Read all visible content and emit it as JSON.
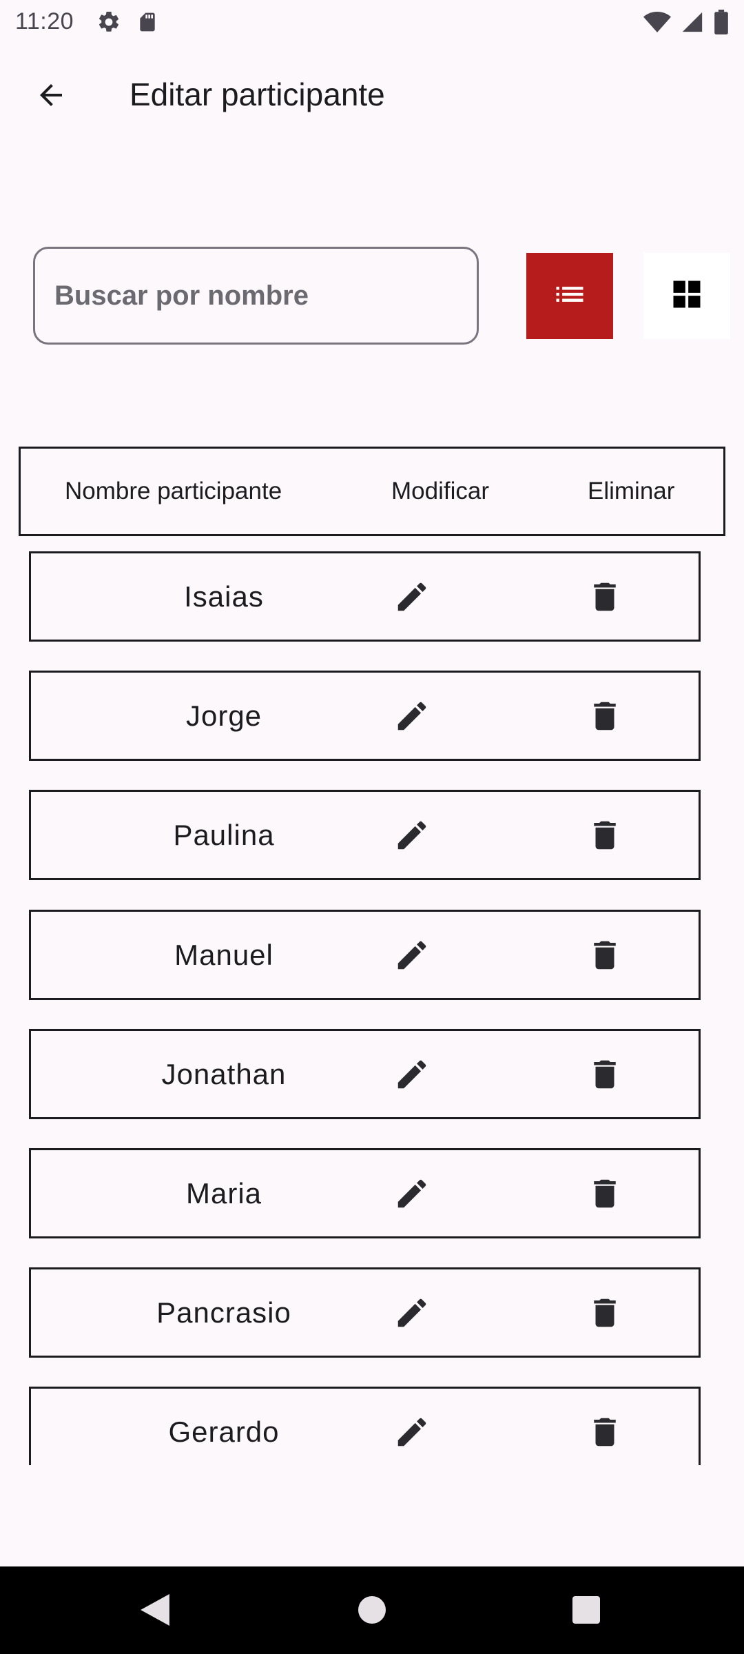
{
  "status_bar": {
    "time": "11:20",
    "left_icons": [
      "settings-icon",
      "sd-card-icon"
    ],
    "right_icons": [
      "wifi-icon",
      "signal-icon",
      "battery-icon"
    ]
  },
  "app_bar": {
    "title": "Editar participante",
    "back_icon": "arrow-back-icon"
  },
  "search": {
    "placeholder": "Buscar por nombre",
    "value": ""
  },
  "view_toggle": {
    "active": "list",
    "active_color": "#b71c1c",
    "list_icon": "list-icon",
    "grid_icon": "grid-icon"
  },
  "table": {
    "headers": {
      "name": "Nombre participante",
      "modify": "Modificar",
      "delete": "Eliminar"
    },
    "rows": [
      {
        "name": "Isaias"
      },
      {
        "name": "Jorge"
      },
      {
        "name": "Paulina"
      },
      {
        "name": "Manuel"
      },
      {
        "name": "Jonathan"
      },
      {
        "name": "Maria"
      },
      {
        "name": "Pancrasio"
      },
      {
        "name": "Gerardo"
      }
    ],
    "edit_icon": "pencil-icon",
    "delete_icon": "trash-icon"
  },
  "nav_bar": {
    "buttons": [
      "back-triangle-icon",
      "home-circle-icon",
      "recents-square-icon"
    ]
  }
}
